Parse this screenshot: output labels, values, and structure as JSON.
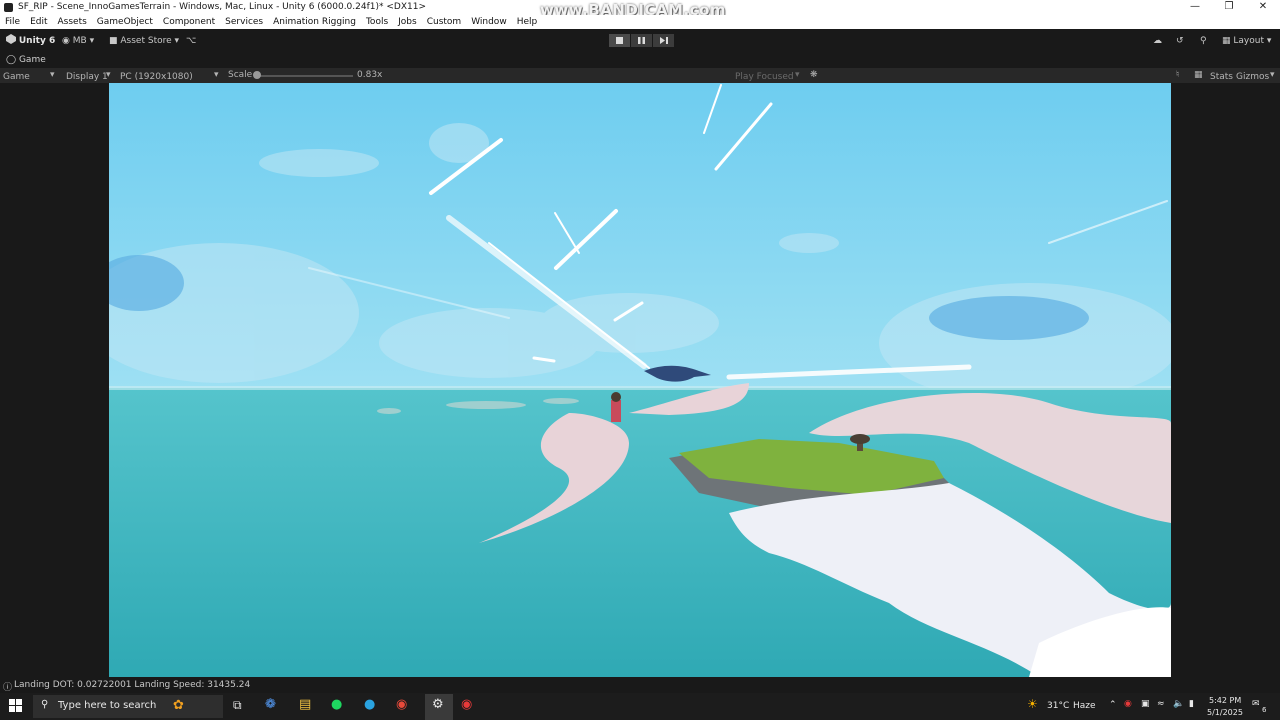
{
  "window": {
    "title": "SF_RIP - Scene_InnoGamesTerrain - Windows, Mac, Linux - Unity 6 (6000.0.24f1)* <DX11>",
    "watermark": "www.BANDICAM.com"
  },
  "menu": [
    "File",
    "Edit",
    "Assets",
    "GameObject",
    "Component",
    "Services",
    "Animation Rigging",
    "Tools",
    "Jobs",
    "Custom",
    "Window",
    "Help"
  ],
  "toolbar": {
    "account": "Unity 6",
    "user": "MB",
    "asset_store": "Asset Store",
    "layout": "Layout"
  },
  "tab": {
    "label": "Game"
  },
  "gamebar": {
    "view": "Game",
    "display": "Display 1",
    "resolution": "PC (1920x1080)",
    "scale_label": "Scale",
    "scale_value": "0.83x",
    "play_mode": "Play Focused",
    "stats": "Stats",
    "gizmos": "Gizmos"
  },
  "status": {
    "message": "Landing DOT: 0.02722001 Landing Speed: 31435.24"
  },
  "taskbar": {
    "search_placeholder": "Type here to search",
    "weather": "31°C",
    "weather_desc": "Haze",
    "time": "5:42 PM",
    "date": "5/1/2025",
    "notification_count": "6"
  },
  "colors": {
    "sky": "#6ecdf0",
    "sea": "#3cb5bf",
    "grass": "#7fb23e",
    "editor_bg": "#191919"
  }
}
